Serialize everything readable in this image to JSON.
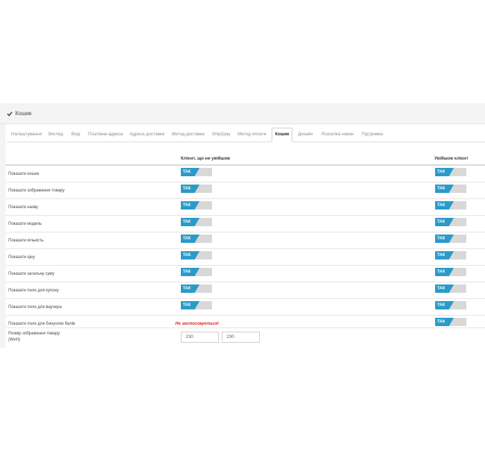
{
  "panel": {
    "title": "Кошик"
  },
  "tabs": [
    {
      "label": "Налаштування",
      "active": false
    },
    {
      "label": "Вигляд",
      "active": false
    },
    {
      "label": "Вхід",
      "active": false
    },
    {
      "label": "Платіжна адреса",
      "active": false
    },
    {
      "label": "Адреса доставки",
      "active": false
    },
    {
      "label": "Метод доставки",
      "active": false
    },
    {
      "label": "Ship2pay",
      "active": false
    },
    {
      "label": "Метод оплати",
      "active": false
    },
    {
      "label": "Кошик",
      "active": true
    },
    {
      "label": "Дизайн",
      "active": false
    },
    {
      "label": "Розсилка новин",
      "active": false
    },
    {
      "label": "Підтримка",
      "active": false
    }
  ],
  "columns": {
    "guest": "Клієнт, що не увійшов",
    "logged": "Увійшов клієнт"
  },
  "toggle_on_label": "ТАК",
  "rows": [
    {
      "label": "Показати кошик",
      "guest": "on",
      "logged": "on"
    },
    {
      "label": "Показати зображення товару",
      "guest": "on",
      "logged": "on"
    },
    {
      "label": "Показати назву",
      "guest": "on",
      "logged": "on"
    },
    {
      "label": "Показати модель",
      "guest": "on",
      "logged": "on"
    },
    {
      "label": "Показати кількість",
      "guest": "on",
      "logged": "on"
    },
    {
      "label": "Показати ціну",
      "guest": "on",
      "logged": "on"
    },
    {
      "label": "Показати загальну суму",
      "guest": "on",
      "logged": "on"
    },
    {
      "label": "Показати поле для купону",
      "guest": "on",
      "logged": "on"
    },
    {
      "label": "Показати поле для ваучера",
      "guest": "on",
      "logged": "on"
    },
    {
      "label": "Показати поле для бонусних балів",
      "guest": "na",
      "logged": "on"
    }
  ],
  "not_applicable_text": "Не застосовується!",
  "image_size": {
    "label_line1": "Розмір зображення товару:",
    "label_line2": "(WxH)",
    "width": "230",
    "height": "230"
  },
  "colors": {
    "toggle_on": "#2a9bc9",
    "toggle_off": "#d8d8d8",
    "not_applicable": "#e02020"
  }
}
